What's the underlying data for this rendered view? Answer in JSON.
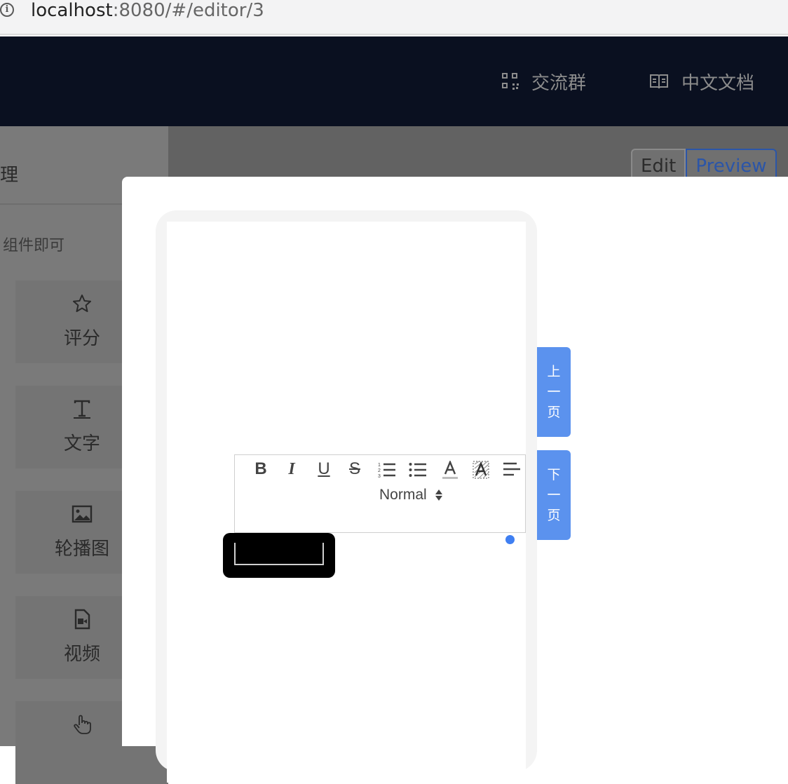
{
  "browser": {
    "url_host": "localhost",
    "url_rest": ":8080/#/editor/3"
  },
  "header": {
    "nav": [
      {
        "label": "交流群",
        "icon": "qrcode-icon"
      },
      {
        "label": "中文文档",
        "icon": "book-icon"
      }
    ]
  },
  "sidebar": {
    "title": "理",
    "hint": "组件即可",
    "components": [
      {
        "label": "评分",
        "icon": "star-icon"
      },
      {
        "label": "文字",
        "icon": "text-icon"
      },
      {
        "label": "轮播图",
        "icon": "picture-icon"
      },
      {
        "label": "视频",
        "icon": "video-icon"
      },
      {
        "label": "",
        "icon": "pointer-hand-icon"
      }
    ]
  },
  "mode_toggle": {
    "edit": "Edit",
    "preview": "Preview",
    "active": "Preview"
  },
  "editor": {
    "toolbar": {
      "bold": "B",
      "italic": "I",
      "underline": "U",
      "strike": "S",
      "size_select": "Normal"
    }
  },
  "pager": {
    "prev": [
      "上",
      "一",
      "页"
    ],
    "next": [
      "下",
      "一",
      "页"
    ]
  },
  "colors": {
    "header_bg": "#0a1020",
    "accent": "#5b92ee",
    "handle": "#3f7ff2"
  }
}
